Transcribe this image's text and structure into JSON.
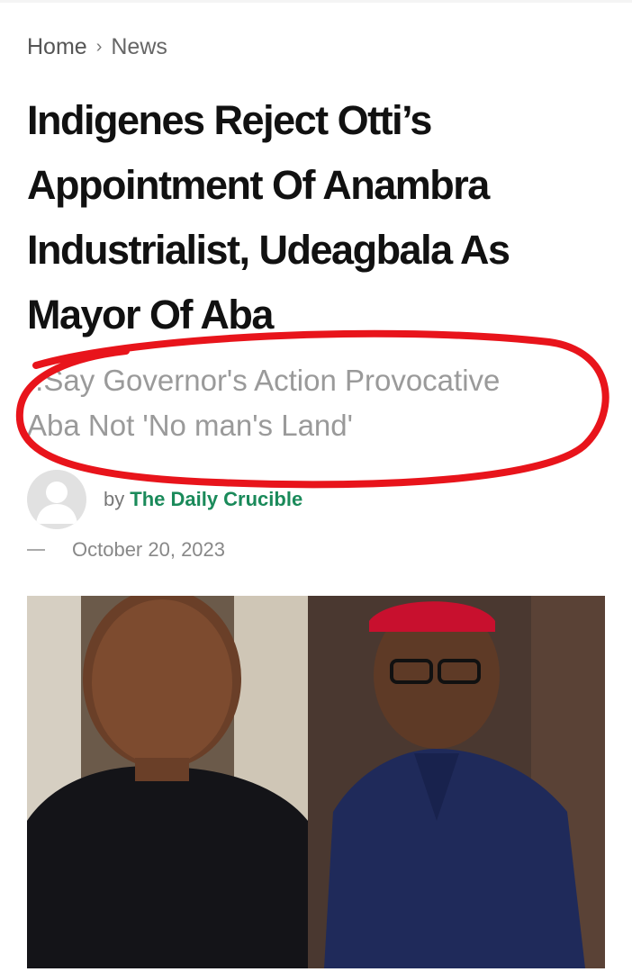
{
  "breadcrumb": {
    "home": "Home",
    "separator": "›",
    "current": "News"
  },
  "article": {
    "title": "Indigenes Reject Otti’s Appointment Of Anambra Industrialist, Udeagbala As Mayor Of Aba",
    "subtitle_line1": "..Say Governor's Action Provocative",
    "subtitle_line2": "Aba Not 'No man's Land'",
    "author_prefix": "by",
    "author_name": "The Daily Crucible",
    "date": "October 20, 2023"
  },
  "colors": {
    "author_link": "#1a8a5a",
    "highlight_ring": "#e8141b",
    "title": "#111111",
    "subtitle": "#9a9a9a"
  },
  "icons": {
    "avatar": "default-user-avatar-icon",
    "separator": "chevron-right-icon"
  }
}
